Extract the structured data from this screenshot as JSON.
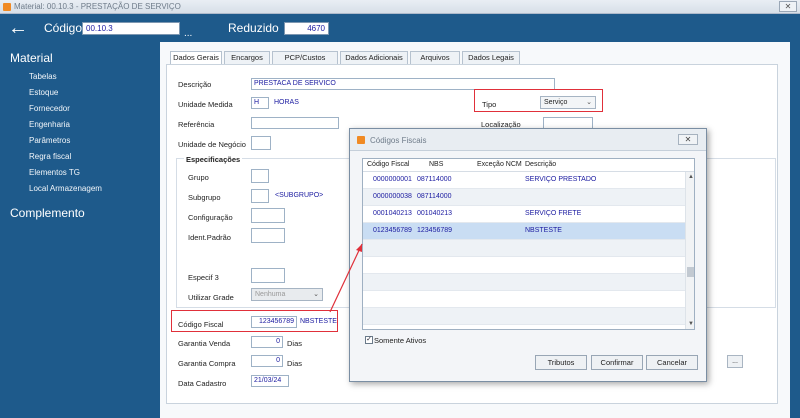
{
  "window": {
    "title": "Material: 00.10.3 - PRESTAÇÃO DE SERVIÇO",
    "close": "✕"
  },
  "header": {
    "codigo_label": "Código",
    "codigo_value": "00.10.3",
    "dots": "...",
    "reduzido_label": "Reduzido",
    "reduzido_value": "4670"
  },
  "sidebar": {
    "section1": "Material",
    "items": [
      "Tabelas",
      "Estoque",
      "Fornecedor",
      "Engenharia",
      "Parâmetros",
      "Regra fiscal",
      "Elementos TG",
      "Local Armazenagem"
    ],
    "section2": "Complemento"
  },
  "tabs": [
    "Dados Gerais",
    "Encargos",
    "PCP/Custos",
    "Dados Adicionais",
    "Arquivos",
    "Dados Legais"
  ],
  "form": {
    "descricao_label": "Descrição",
    "descricao_value": "PRESTACA DE SERVICO",
    "unidade_label": "Unidade Medida",
    "unidade_value": "H",
    "unidade_desc": "HORAS",
    "tipo_label": "Tipo",
    "tipo_value": "Serviço",
    "referencia_label": "Referência",
    "localizacao_label": "Localização",
    "unidade_negocio_label": "Unidade de Negócio",
    "especificacoes_label": "Especificações",
    "grupo_label": "Grupo",
    "subgrupo_label": "Subgrupo",
    "subgrupo_desc": "<SUBGRUPO>",
    "configuracao_label": "Configuração",
    "ident_label": "Ident.Padrão",
    "especif3_label": "Especif 3",
    "utilizar_grade_label": "Utilizar Grade",
    "utilizar_grade_value": "Nenhuma",
    "codigo_fiscal_label": "Código Fiscal",
    "codigo_fiscal_value": "123456789",
    "codigo_fiscal_desc": "NBSTESTE",
    "garantia_venda_label": "Garantia Venda",
    "garantia_venda_value": "0",
    "garantia_venda_unit": "Dias",
    "garantia_compra_label": "Garantia Compra",
    "garantia_compra_value": "0",
    "garantia_compra_unit": "Dias",
    "data_cadastro_label": "Data Cadastro",
    "data_cadastro_value": "21/03/24",
    "extra_button": "..."
  },
  "dialog": {
    "title": "Códigos Fiscais",
    "close": "✕",
    "columns": [
      "Código Fiscal",
      "NBS",
      "Exceção NCM",
      "Descrição"
    ],
    "rows": [
      {
        "codigo": "0000000001",
        "nbs": "087114000",
        "excecao": "",
        "descricao": "SERVIÇO PRESTADO"
      },
      {
        "codigo": "0000000038",
        "nbs": "087114000",
        "excecao": "",
        "descricao": ""
      },
      {
        "codigo": "0001040213",
        "nbs": "001040213",
        "excecao": "",
        "descricao": "SERVIÇO FRETE"
      },
      {
        "codigo": "0123456789",
        "nbs": "123456789",
        "excecao": "",
        "descricao": "NBSTESTE"
      }
    ],
    "selected_row": 3,
    "somente_ativos_label": "Somente Ativos",
    "somente_ativos_checked": "✓",
    "buttons": {
      "tributos": "Tributos",
      "confirmar": "Confirmar",
      "cancelar": "Cancelar"
    }
  },
  "colors": {
    "brand_blue": "#1e5a8b",
    "highlight_red": "#e0303a",
    "value_blue": "#1a1aa0",
    "selected_row": "#c9ddf3"
  }
}
